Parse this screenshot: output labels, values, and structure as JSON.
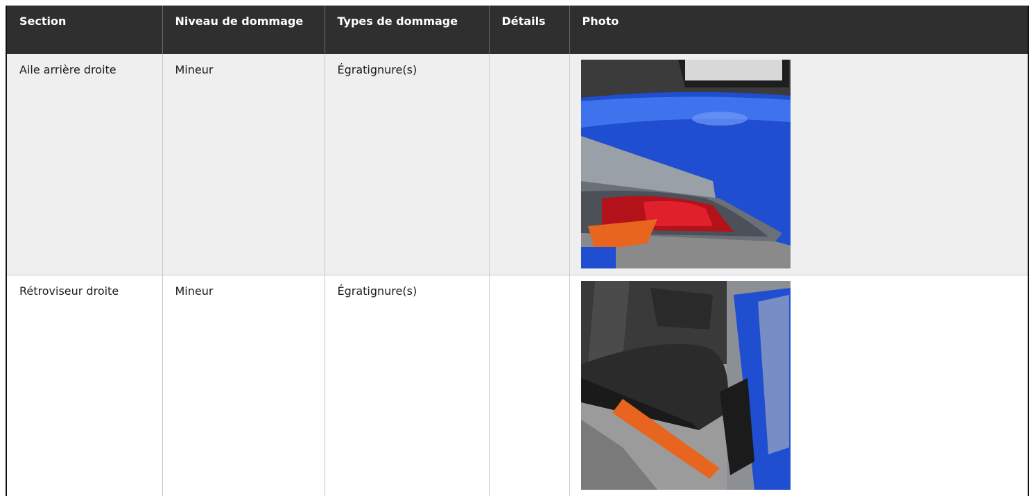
{
  "table": {
    "headers": [
      "Section",
      "Niveau de dommage",
      "Types de dommage",
      "Détails",
      "Photo"
    ],
    "rows": [
      {
        "section": "Aile arrière droite",
        "niveau": "Mineur",
        "types": "Égratignure(s)",
        "details": "",
        "photo": "rear-fender-taillight-photo"
      },
      {
        "section": "Rétroviseur droite",
        "niveau": "Mineur",
        "types": "Égratignure(s)",
        "details": "",
        "photo": "right-mirror-photo"
      }
    ]
  },
  "colors": {
    "header_bg": "#2f2f2f",
    "row_alt_bg": "#efefef",
    "vehicle_blue": "#1f4fd0",
    "frame_orange": "#e8651f"
  }
}
